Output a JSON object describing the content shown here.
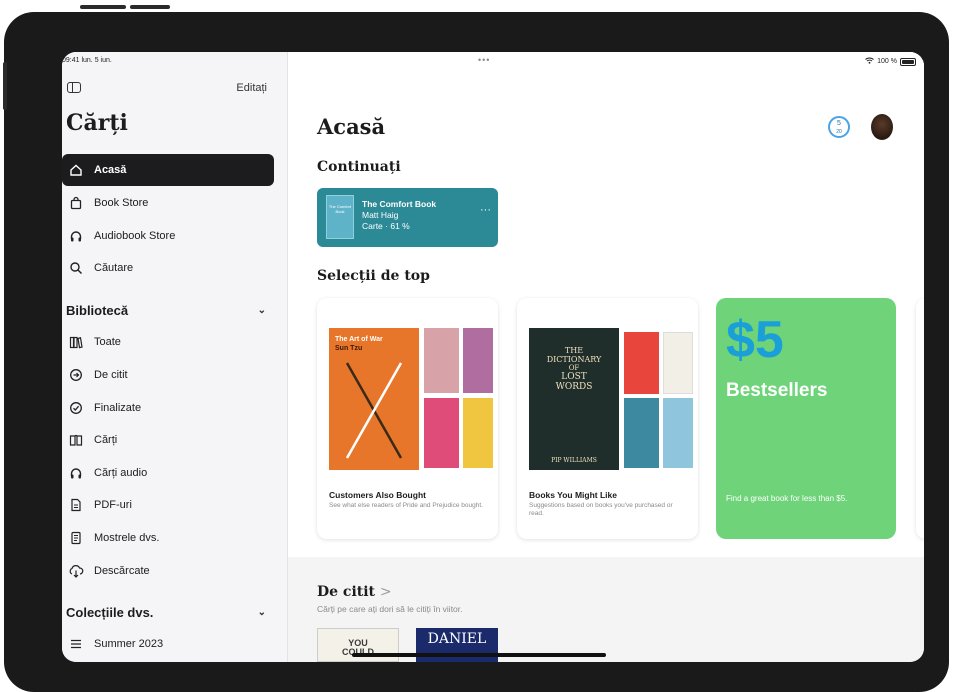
{
  "status_bar": {
    "time": "09:41  lun. 5 iun.",
    "dots": "•••",
    "battery": "100 %"
  },
  "sidebar": {
    "edit_label": "Editați",
    "title": "Cărți",
    "nav": [
      {
        "label": "Acasă",
        "icon": "house-icon"
      },
      {
        "label": "Book Store",
        "icon": "bag-icon"
      },
      {
        "label": "Audiobook Store",
        "icon": "headphones-icon"
      },
      {
        "label": "Căutare",
        "icon": "search-icon"
      }
    ],
    "library_header": "Bibliotecă",
    "library": [
      {
        "label": "Toate",
        "icon": "books-icon"
      },
      {
        "label": "De citit",
        "icon": "arrow-circle-icon"
      },
      {
        "label": "Finalizate",
        "icon": "checkmark-circle-icon"
      },
      {
        "label": "Cărți",
        "icon": "open-book-icon"
      },
      {
        "label": "Cărți audio",
        "icon": "headphones-icon"
      },
      {
        "label": "PDF-uri",
        "icon": "document-icon"
      },
      {
        "label": "Mostrele dvs.",
        "icon": "sample-doc-icon"
      },
      {
        "label": "Descărcate",
        "icon": "cloud-download-icon"
      }
    ],
    "collections_header": "Colecțiile dvs.",
    "collections": [
      {
        "label": "Summer 2023",
        "icon": "list-icon"
      }
    ]
  },
  "main": {
    "title": "Acasă",
    "goal_badge": {
      "top": "5",
      "bottom": "20"
    },
    "continue_title": "Continuați",
    "continue_book": {
      "cover_text": "The Comfort Book",
      "title": "The Comfort Book",
      "author": "Matt Haig",
      "progress": "Carte · 61 %"
    },
    "top_picks_title": "Selecții de top",
    "cards": [
      {
        "name": "Customers Also Bought",
        "description": "See what else readers of Pride and Prejudice bought.",
        "main_cover": {
          "title": "The Art of War",
          "author": "Sun Tzu"
        }
      },
      {
        "name": "Books You Might Like",
        "description": "Suggestions based on books you've purchased or read.",
        "main_cover": {
          "line1": "THE",
          "line2": "DICTIONARY",
          "line3": "OF",
          "line4": "LOST",
          "line5": "WORDS",
          "author": "PIP WILLIAMS"
        }
      }
    ],
    "promo": {
      "big": "$5",
      "label": "Bestsellers",
      "description": "Find a great book for less than $5."
    },
    "to_read": {
      "title": "De citit",
      "arrow": ">",
      "subtitle": "Cărți pe care ați dori să le citiți în viitor.",
      "books": [
        {
          "text": "YOU\nCOULD"
        },
        {
          "text": "DANIEL"
        }
      ]
    }
  },
  "colors": {
    "accent_teal": "#2c8a97",
    "promo_green": "#6fd37a",
    "promo_blue": "#1a9fd8"
  }
}
